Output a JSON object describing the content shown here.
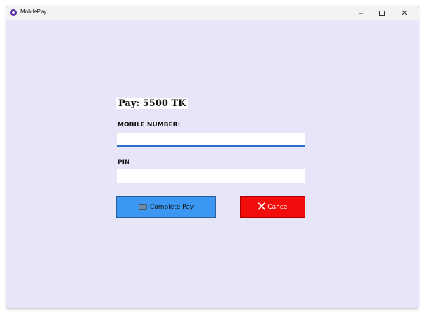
{
  "window": {
    "title": "MobilePay",
    "icon": "app-logo-icon",
    "controls": {
      "minimize": "–",
      "maximize_icon": "square-icon",
      "close": "✕"
    }
  },
  "payment": {
    "amount_text": "Pay: 5500 TK",
    "mobile_label": "MOBILE NUMBER:",
    "mobile_value": "",
    "pin_label": "PIN",
    "pin_value": ""
  },
  "buttons": {
    "complete_label": "Complete Pay",
    "complete_icon": "credit-card-icon",
    "cancel_label": "Cancel",
    "cancel_icon": "x-icon"
  },
  "colors": {
    "background": "#e6e6f8",
    "complete_button": "#3b97f2",
    "cancel_button": "#f30c0c",
    "input_focus_underline": "#2b6fc5"
  }
}
